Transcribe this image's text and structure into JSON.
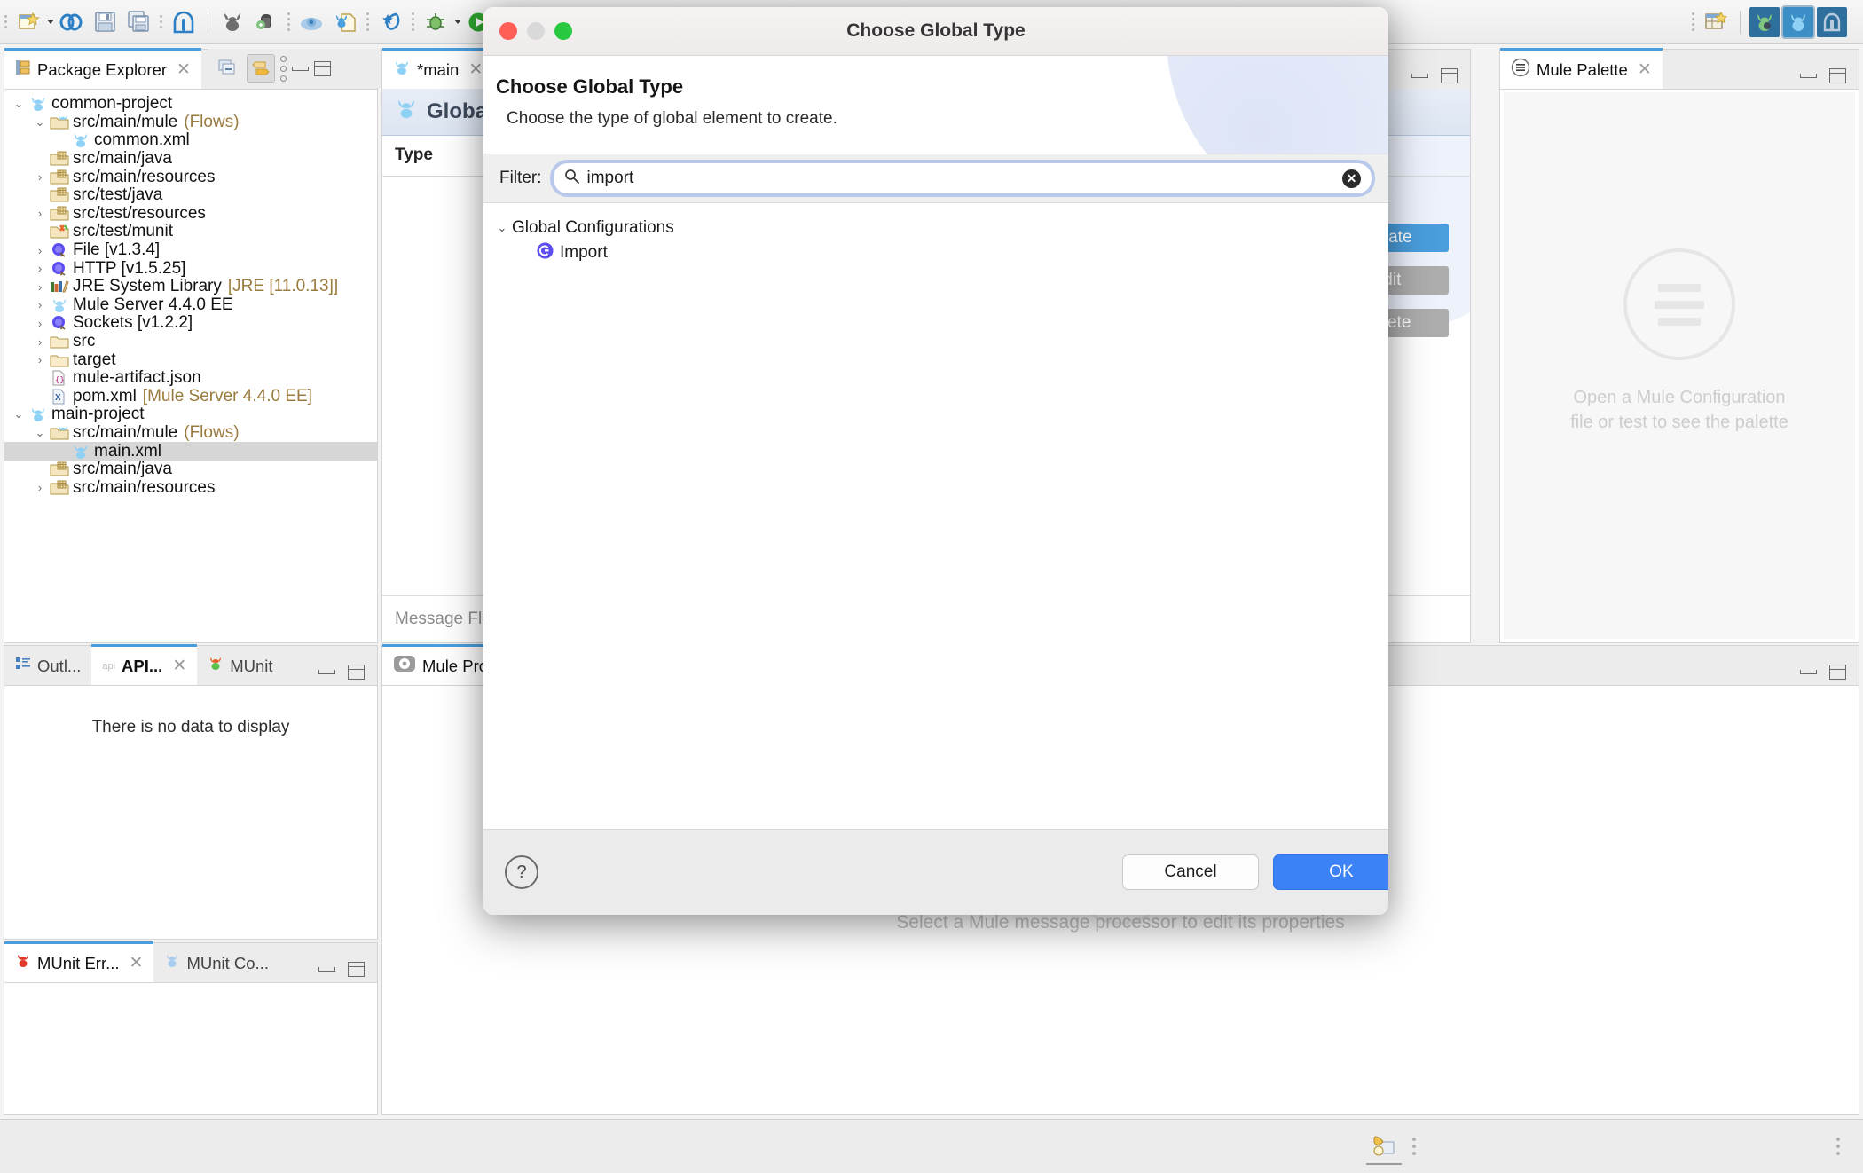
{
  "toolbar": {
    "left_icons": [
      "new-wizard-icon",
      "mule-link-icon",
      "save-icon",
      "save-all-icon",
      "anypoint-icon"
    ],
    "mid_icons": [
      "mule-runtime-icon",
      "deploy-icon",
      "cloudhub-icon",
      "import-project-icon",
      "munit-icon",
      "debug-icon",
      "run-icon"
    ],
    "right_icons": [
      "open-perspective-icon",
      "anypoint-studio-perspective-icon",
      "mule-design-perspective-icon",
      "anypoint-home-perspective-icon"
    ]
  },
  "package_explorer": {
    "tab_label": "Package Explorer",
    "tab_icon": "package-explorer-icon",
    "close_icon": "close-icon",
    "tools": [
      "collapse-all-icon",
      "link-with-editor-icon",
      "view-menu-icon",
      "minimize-icon",
      "maximize-icon"
    ],
    "tree": [
      {
        "indent": 0,
        "arrow": "down",
        "icon": "mule-project-icon",
        "label": "common-project",
        "sub": ""
      },
      {
        "indent": 1,
        "arrow": "down",
        "icon": "mule-folder-icon",
        "label": "src/main/mule",
        "sub": "(Flows)"
      },
      {
        "indent": 2,
        "arrow": "",
        "icon": "mule-file-icon",
        "label": "common.xml",
        "sub": ""
      },
      {
        "indent": 1,
        "arrow": "",
        "icon": "source-folder-icon",
        "label": "src/main/java",
        "sub": ""
      },
      {
        "indent": 1,
        "arrow": "right",
        "icon": "source-folder-icon",
        "label": "src/main/resources",
        "sub": ""
      },
      {
        "indent": 1,
        "arrow": "",
        "icon": "source-folder-icon",
        "label": "src/test/java",
        "sub": ""
      },
      {
        "indent": 1,
        "arrow": "right",
        "icon": "source-folder-icon",
        "label": "src/test/resources",
        "sub": ""
      },
      {
        "indent": 1,
        "arrow": "",
        "icon": "munit-folder-icon",
        "label": "src/test/munit",
        "sub": ""
      },
      {
        "indent": 1,
        "arrow": "right",
        "icon": "connector-icon",
        "label": "File [v1.3.4]",
        "sub": ""
      },
      {
        "indent": 1,
        "arrow": "right",
        "icon": "connector-icon",
        "label": "HTTP [v1.5.25]",
        "sub": ""
      },
      {
        "indent": 1,
        "arrow": "right",
        "icon": "jre-library-icon",
        "label": "JRE System Library",
        "sub": "[JRE [11.0.13]]"
      },
      {
        "indent": 1,
        "arrow": "right",
        "icon": "mule-server-icon",
        "label": "Mule Server 4.4.0 EE",
        "sub": ""
      },
      {
        "indent": 1,
        "arrow": "right",
        "icon": "connector-icon",
        "label": "Sockets [v1.2.2]",
        "sub": ""
      },
      {
        "indent": 1,
        "arrow": "right",
        "icon": "folder-icon",
        "label": "src",
        "sub": ""
      },
      {
        "indent": 1,
        "arrow": "right",
        "icon": "folder-icon",
        "label": "target",
        "sub": ""
      },
      {
        "indent": 1,
        "arrow": "",
        "icon": "json-file-icon",
        "label": "mule-artifact.json",
        "sub": ""
      },
      {
        "indent": 1,
        "arrow": "",
        "icon": "xml-file-icon",
        "label": "pom.xml",
        "sub": "[Mule Server 4.4.0 EE]"
      },
      {
        "indent": 0,
        "arrow": "down",
        "icon": "mule-project-icon",
        "label": "main-project",
        "sub": ""
      },
      {
        "indent": 1,
        "arrow": "down",
        "icon": "mule-folder-icon",
        "label": "src/main/mule",
        "sub": "(Flows)"
      },
      {
        "indent": 2,
        "arrow": "",
        "icon": "mule-file-icon",
        "label": "main.xml",
        "sub": "",
        "selected": true
      },
      {
        "indent": 1,
        "arrow": "",
        "icon": "source-folder-icon",
        "label": "src/main/java",
        "sub": ""
      },
      {
        "indent": 1,
        "arrow": "right",
        "icon": "source-folder-icon",
        "label": "src/main/resources",
        "sub": ""
      }
    ]
  },
  "outline_panel": {
    "tabs": [
      {
        "label": "Outl...",
        "icon": "outline-icon",
        "active": false
      },
      {
        "label": "API...",
        "icon": "api-icon",
        "active": true,
        "closeable": true
      },
      {
        "label": "MUnit",
        "icon": "munit-icon",
        "active": false
      }
    ],
    "empty_message": "There is no data to display"
  },
  "munit_panel": {
    "tabs": [
      {
        "label": "MUnit Err...",
        "icon": "munit-error-icon",
        "active": true,
        "closeable": true
      },
      {
        "label": "MUnit Co...",
        "icon": "munit-coverage-icon",
        "active": false
      }
    ]
  },
  "editor": {
    "tabs": [
      {
        "label": "*main",
        "icon": "mule-file-icon",
        "active": true,
        "closeable": true
      }
    ],
    "global_tab_label": "Global Elements",
    "global_tab_icon": "mule-file-icon",
    "column_header": "Type",
    "buttons": {
      "create": "Create",
      "edit": "Edit",
      "delete": "Delete"
    },
    "bottom_tab": "Message Flow"
  },
  "properties": {
    "tab_label": "Mule Properties",
    "tab_icon": "mule-properties-icon",
    "empty_message": "Select a Mule message processor to edit its properties"
  },
  "palette": {
    "tab_label": "Mule Palette",
    "tab_icon": "palette-menu-icon",
    "close_icon": "close-icon",
    "empty_message_line1": "Open a Mule Configuration",
    "empty_message_line2": "file or test to see the palette"
  },
  "dialog": {
    "window_title": "Choose Global Type",
    "heading": "Choose Global Type",
    "description": "Choose the type of global element to create.",
    "filter_label": "Filter:",
    "search_icon": "search-icon",
    "search_value": "import",
    "clear_icon": "clear-icon",
    "tree": {
      "group_label": "Global Configurations",
      "group_arrow": "down",
      "items": [
        {
          "label": "Import",
          "icon": "global-config-icon"
        }
      ]
    },
    "help_label": "?",
    "cancel_label": "Cancel",
    "ok_label": "OK"
  },
  "statusbar": {
    "icon": "build-status-icon"
  },
  "colors": {
    "accent_blue": "#4a9edd",
    "primary_button": "#3b82f6",
    "tab_highlight": "#4a9edd",
    "folder_sub_text": "#9a7b3f"
  }
}
